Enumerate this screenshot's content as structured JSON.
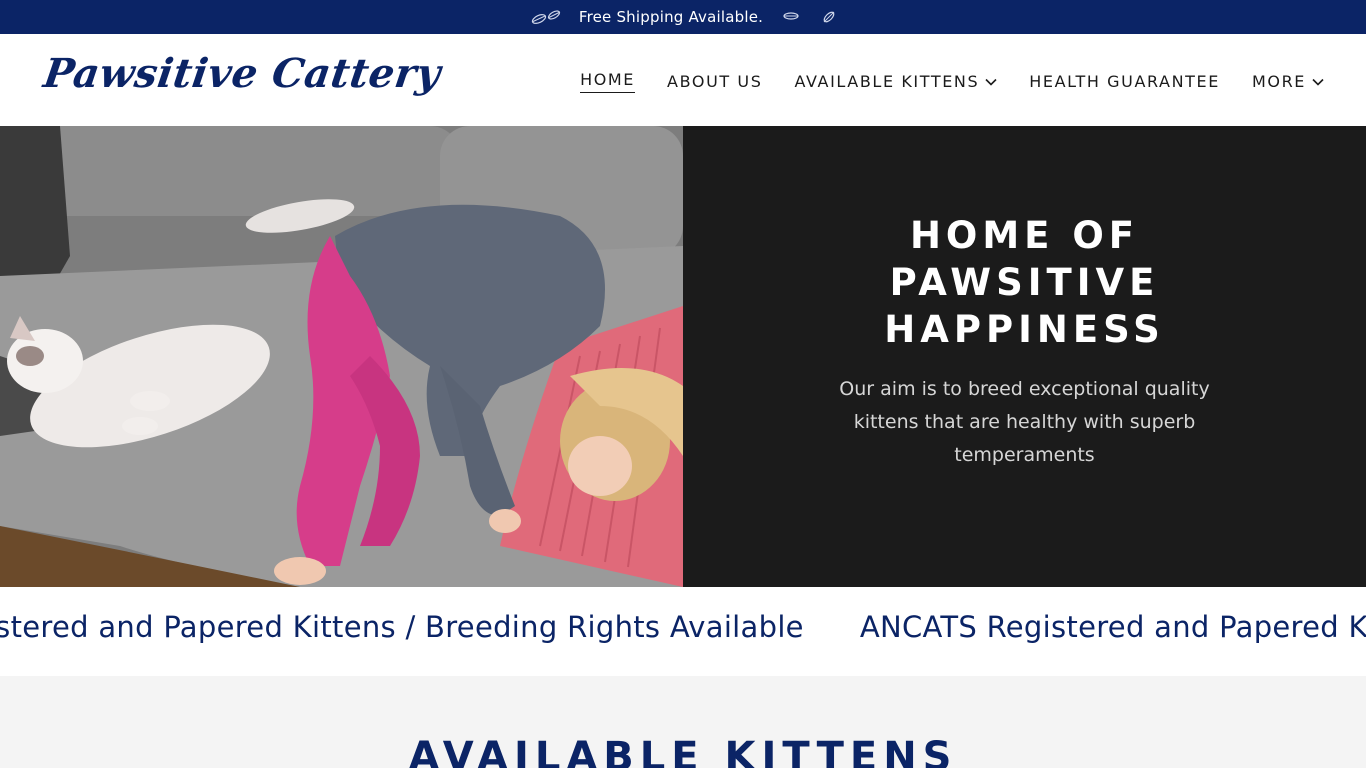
{
  "announcement": {
    "text": "Free Shipping Available.",
    "icons": [
      "leaf-icon",
      "leaf-icon",
      "leaf-icon",
      "leaf-icon"
    ]
  },
  "header": {
    "logo": "Pawsitive Cattery",
    "nav": [
      {
        "label": "HOME",
        "active": true,
        "has_dropdown": false
      },
      {
        "label": "ABOUT US",
        "active": false,
        "has_dropdown": false
      },
      {
        "label": "AVAILABLE KITTENS",
        "active": false,
        "has_dropdown": true
      },
      {
        "label": "HEALTH GUARANTEE",
        "active": false,
        "has_dropdown": false
      },
      {
        "label": "MORE",
        "active": false,
        "has_dropdown": true
      }
    ]
  },
  "hero": {
    "title": "HOME OF PAWSITIVE HAPPINESS",
    "subtitle": "Our aim is to breed exceptional quality kittens that are healthy with superb temperaments"
  },
  "marquee": {
    "items": [
      "ANCATS Registered and Papered Kittens / Breeding Rights Available",
      "ANCATS Registered and Papered Kittens / Breeding Rights Available"
    ]
  },
  "section": {
    "title": "AVAILABLE KITTENS"
  },
  "colors": {
    "brand_navy": "#0b2466",
    "hero_panel": "#1b1b1b",
    "section_bg": "#f4f4f4"
  }
}
